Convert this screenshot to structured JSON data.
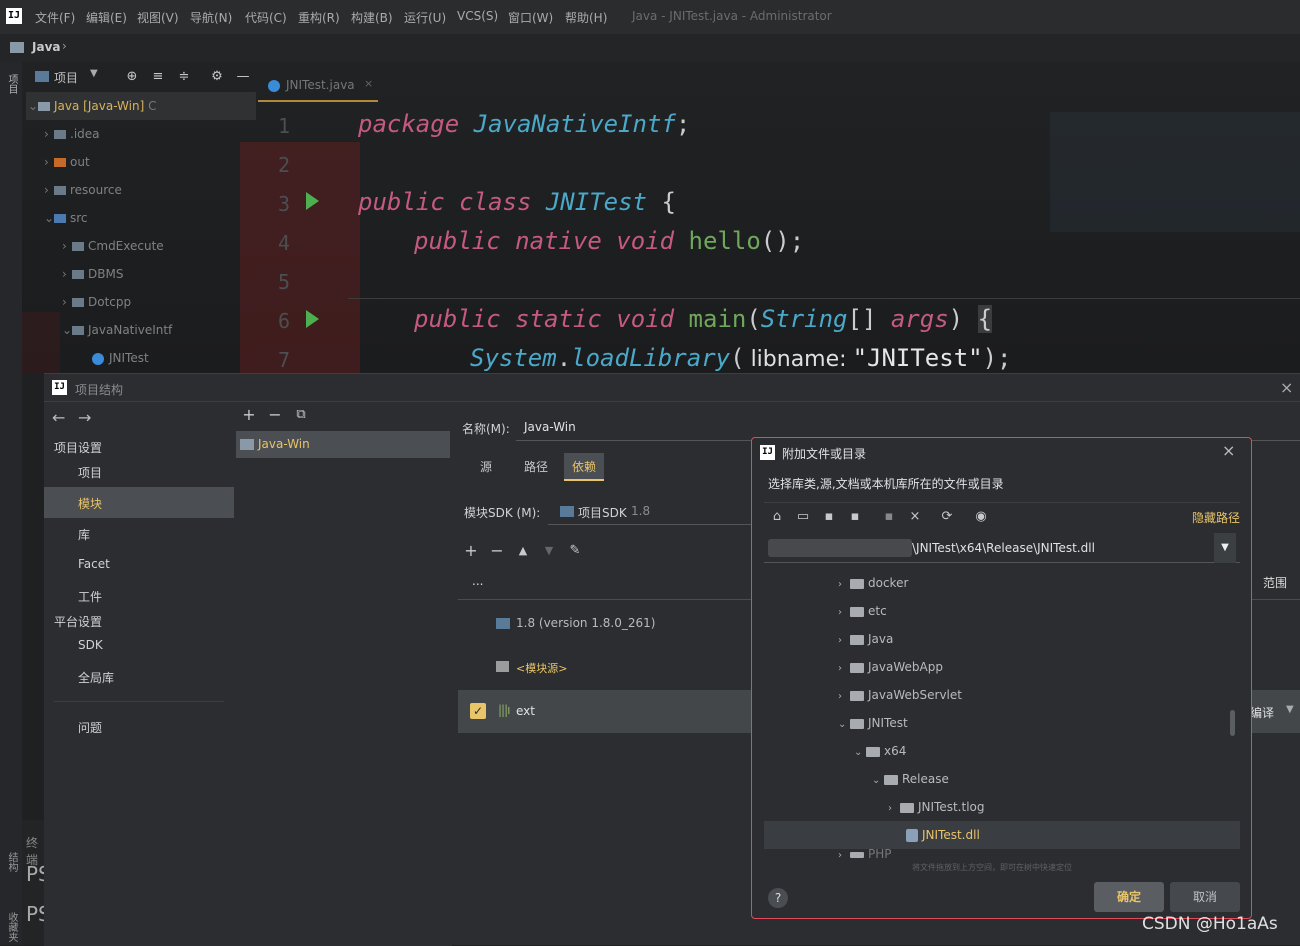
{
  "menubar": {
    "logo": "IJ",
    "items": [
      "文件(F)",
      "编辑(E)",
      "视图(V)",
      "导航(N)",
      "代码(C)",
      "重构(R)",
      "构建(B)",
      "运行(U)",
      "VCS(S)",
      "窗口(W)",
      "帮助(H)"
    ],
    "title": "Java - JNITest.java - Administrator"
  },
  "breadcrumb": {
    "project": "Java"
  },
  "project_panel": {
    "label": "项目",
    "side_tab": "项目",
    "tree": [
      {
        "label": "Java [Java-Win]",
        "extra": "C"
      },
      {
        "label": ".idea"
      },
      {
        "label": "out"
      },
      {
        "label": "resource"
      },
      {
        "label": "src"
      },
      {
        "label": "CmdExecute"
      },
      {
        "label": "DBMS"
      },
      {
        "label": "Dotcpp"
      },
      {
        "label": "JavaNativeIntf"
      },
      {
        "label": "JNITest"
      }
    ]
  },
  "editor": {
    "tab": "JNITest.java",
    "lines": [
      "1",
      "2",
      "3",
      "4",
      "5",
      "6",
      "7"
    ],
    "code": {
      "l1_kw": "package",
      "l1_pkg": "JavaNativeIntf",
      "l1_end": ";",
      "l3_kw": "public class",
      "l3_cls": "JNITest",
      "l3_brace": "{",
      "l4_kw": "public native void",
      "l4_fn": "hello",
      "l4_end": "();",
      "l6_kw": "public static void",
      "l6_fn": "main",
      "l6_p1": "(",
      "l6_type": "String",
      "l6_arr": "[]",
      "l6_arg": "args",
      "l6_p2": ")",
      "l6_brace": "{",
      "l7_cls": "System",
      "l7_dot": ".",
      "l7_fn": "loadLibrary",
      "l7_p1": "(",
      "l7_hint": "libname:",
      "l7_str": "\"JNITest\"",
      "l7_end": ");"
    }
  },
  "bottom_left": {
    "terminal_label": "终端",
    "prompt1": "PS",
    "prompt2": "PS",
    "structure": "结构",
    "favorites": "收藏夹"
  },
  "project_structure": {
    "title": "项目结构",
    "nav_back": "←",
    "nav_fwd": "→",
    "sections": [
      {
        "header": "项目设置",
        "items": [
          "项目",
          "模块",
          "库",
          "Facet",
          "工件"
        ]
      },
      {
        "header": "平台设置",
        "items": [
          "SDK",
          "全局库"
        ]
      }
    ],
    "problems": "问题",
    "selected": "模块",
    "module_list": [
      "Java-Win"
    ],
    "name_label": "名称(M):",
    "name_value": "Java-Win",
    "tabs": [
      "源",
      "路径",
      "依赖"
    ],
    "active_tab": "依赖",
    "sdk_label": "模块SDK (M):",
    "sdk_value": "项目SDK",
    "sdk_version": "1.8",
    "dep_header_dots": "...",
    "scope_header": "范围",
    "deps": [
      {
        "label": "1.8 (version 1.8.0_261)"
      },
      {
        "label": "<模块源>"
      },
      {
        "label": "ext",
        "checked": true,
        "scope": "编译"
      }
    ]
  },
  "attach_dialog": {
    "title": "附加文件或目录",
    "subtitle": "选择库类,源,文档或本机库所在的文件或目录",
    "hide_path": "隐藏路径",
    "path_value": "\\JNITest\\x64\\Release\\JNITest.dll",
    "hint": "将文件拖放到上方空间，即可在树中快速定位",
    "help": "?",
    "ok": "确定",
    "cancel": "取消",
    "tree": [
      {
        "label": "docker",
        "indent": 0,
        "chev": "›"
      },
      {
        "label": "etc",
        "indent": 0,
        "chev": "›"
      },
      {
        "label": "Java",
        "indent": 0,
        "chev": "›"
      },
      {
        "label": "JavaWebApp",
        "indent": 0,
        "chev": "›"
      },
      {
        "label": "JavaWebServlet",
        "indent": 0,
        "chev": "›"
      },
      {
        "label": "JNITest",
        "indent": 0,
        "chev": "⌄"
      },
      {
        "label": "x64",
        "indent": 1,
        "chev": "⌄"
      },
      {
        "label": "Release",
        "indent": 2,
        "chev": "⌄"
      },
      {
        "label": "JNITest.tlog",
        "indent": 3,
        "chev": "›"
      },
      {
        "label": "JNITest.dll",
        "indent": 3,
        "chev": "",
        "selected": true
      }
    ],
    "partial": "PHP"
  },
  "watermark": "CSDN @Ho1aAs"
}
